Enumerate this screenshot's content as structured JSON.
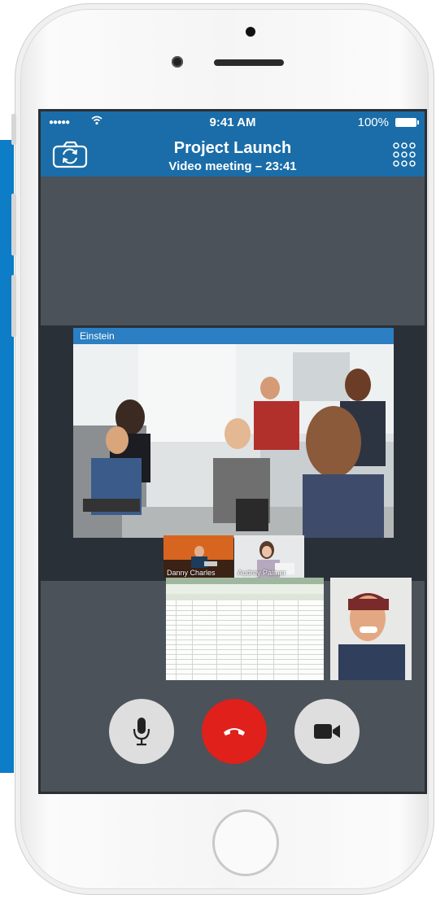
{
  "status": {
    "time": "9:41 AM",
    "battery": "100%"
  },
  "header": {
    "title": "Project Launch",
    "subtitle": "Video meeting – 23:41"
  },
  "main_participant": {
    "name": "Einstein"
  },
  "thumbnails": [
    {
      "name": "Danny Charles"
    },
    {
      "name": "Audrey Palmer"
    },
    {
      "name": ""
    },
    {
      "name": ""
    }
  ],
  "controls": {
    "mute_icon": "microphone-icon",
    "end_icon": "hang-up-icon",
    "video_icon": "video-camera-icon"
  },
  "colors": {
    "accent": "#1a6da8",
    "end_call": "#e0201a",
    "control_bg": "#dedede"
  }
}
